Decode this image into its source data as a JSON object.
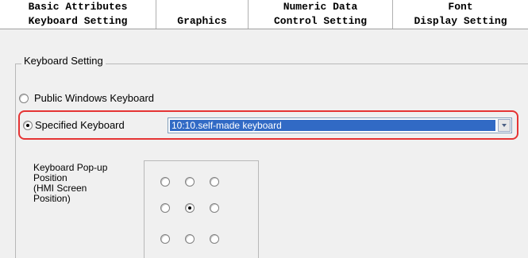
{
  "tabs": {
    "back_row": [
      {
        "label": "Basic Attributes"
      },
      {
        "label": ""
      },
      {
        "label": "Numeric Data"
      },
      {
        "label": "Font"
      }
    ],
    "front_row": [
      {
        "label": "Keyboard Setting",
        "active": true
      },
      {
        "label": "Graphics"
      },
      {
        "label": "Control Setting"
      },
      {
        "label": "Display Setting"
      }
    ]
  },
  "keyboard_group": {
    "title": "Keyboard Setting",
    "options": [
      {
        "label": "Public Windows Keyboard",
        "checked": false
      },
      {
        "label": "Specified Keyboard",
        "checked": true
      }
    ],
    "keyboard_select": {
      "value": "10:10.self-made keyboard"
    },
    "highlight_color": "#e53434"
  },
  "popup_position": {
    "label_lines": [
      "Keyboard Pop-up",
      "Position",
      "(HMI Screen",
      "Position)"
    ],
    "grid": [
      [
        false,
        false,
        false
      ],
      [
        false,
        true,
        false
      ],
      [
        false,
        false,
        false
      ]
    ]
  },
  "colors": {
    "selection_bg": "#316ac5",
    "selection_text": "#ffffff"
  }
}
